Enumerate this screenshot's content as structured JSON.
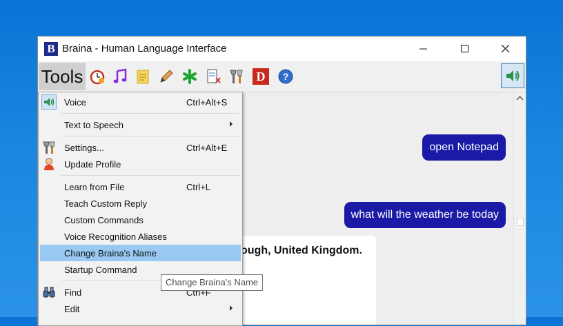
{
  "window": {
    "title": "Braina - Human Language Interface",
    "logo_letter": "B"
  },
  "toolbar": {
    "tools_label": "Tools",
    "d_label": "D",
    "help_label": "?"
  },
  "chat": {
    "user_messages": [
      "open Notepad",
      "what will the weather be today"
    ],
    "bot_partial": "ough, United Kingdom."
  },
  "menu": {
    "voice": {
      "label": "Voice",
      "shortcut": "Ctrl+Alt+S"
    },
    "tts": {
      "label": "Text to Speech"
    },
    "settings": {
      "label": "Settings...",
      "shortcut": "Ctrl+Alt+E"
    },
    "update_profile": {
      "label": "Update Profile"
    },
    "learn_file": {
      "label": "Learn from File",
      "shortcut": "Ctrl+L"
    },
    "teach_reply": {
      "label": "Teach Custom Reply"
    },
    "custom_commands": {
      "label": "Custom Commands"
    },
    "aliases": {
      "label": "Voice Recognition Aliases"
    },
    "change_name": {
      "label": "Change Braina's Name"
    },
    "startup": {
      "label": "Startup Command"
    },
    "find": {
      "label": "Find",
      "shortcut": "Ctrl+F"
    },
    "edit": {
      "label": "Edit"
    }
  },
  "tooltip": {
    "text": "Change Braina's Name"
  },
  "colors": {
    "bubble": "#1a1aa6",
    "highlight": "#99c9f3",
    "desktop": "#0b73d6"
  }
}
